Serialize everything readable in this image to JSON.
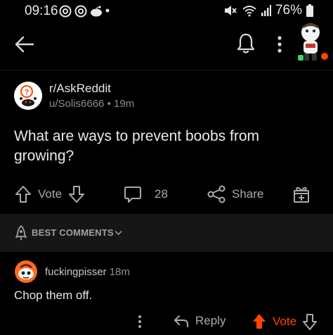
{
  "status_bar": {
    "time": "09:16",
    "battery": "76%",
    "icons": [
      "threads-icon",
      "threads-icon",
      "reddit-icon",
      "dot-icon",
      "mute-icon",
      "wifi-icon",
      "signal-icon",
      "battery-icon"
    ]
  },
  "header": {
    "icons": [
      "back-arrow-icon",
      "bell-icon",
      "kebab-menu-icon",
      "user-avatar"
    ]
  },
  "post": {
    "subreddit": "r/AskReddit",
    "author": "u/Solis6666",
    "separator": "•",
    "age": "19m",
    "title": "What are ways to prevent boobs from growing?"
  },
  "actions": {
    "vote_label": "Vote",
    "comment_count": "28",
    "share_label": "Share"
  },
  "sort": {
    "label": "BEST COMMENTS"
  },
  "comment": {
    "author": "fuckingpisser",
    "age": "18m",
    "body": "Chop them off.",
    "reply_label": "Reply",
    "vote_label": "Vote"
  },
  "colors": {
    "background": "#000000",
    "upvote_active": "#ff4500",
    "text_primary": "#e4e6e8",
    "text_secondary": "#8a8c8e"
  }
}
